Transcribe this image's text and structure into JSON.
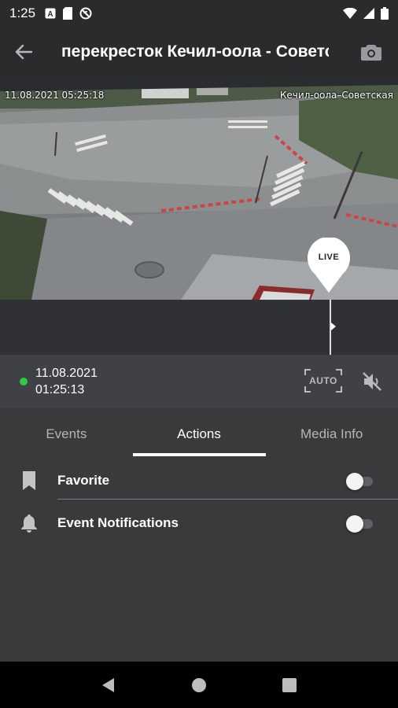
{
  "status_bar": {
    "time": "1:25",
    "left_icons": [
      "a-badge-icon",
      "sim-card-icon",
      "no-signal-icon"
    ],
    "right_icons": [
      "wifi-icon",
      "cell-signal-icon",
      "battery-icon"
    ]
  },
  "app_bar": {
    "title": "перекресток Кечил-оола - Советская",
    "back_icon": "arrow-back-icon",
    "snapshot_icon": "camera-icon"
  },
  "video": {
    "osd_timestamp": "11.08.2021 05:25:18",
    "osd_location": "Кечил-оола–Советская",
    "live_label": "LIVE"
  },
  "info_bar": {
    "date": "11.08.2021",
    "time": "01:25:13",
    "auto_label": "AUTO",
    "status_color": "#2ecc40"
  },
  "tabs": {
    "items": [
      {
        "label": "Events"
      },
      {
        "label": "Actions"
      },
      {
        "label": "Media Info"
      }
    ],
    "active": "Actions"
  },
  "actions": {
    "favorite": {
      "label": "Favorite",
      "enabled": false,
      "icon": "bookmark-icon"
    },
    "notifications": {
      "label": "Event Notifications",
      "enabled": false,
      "icon": "bell-icon"
    }
  },
  "nav_bar": {
    "buttons": [
      "back-triangle-icon",
      "home-circle-icon",
      "recents-square-icon"
    ]
  }
}
